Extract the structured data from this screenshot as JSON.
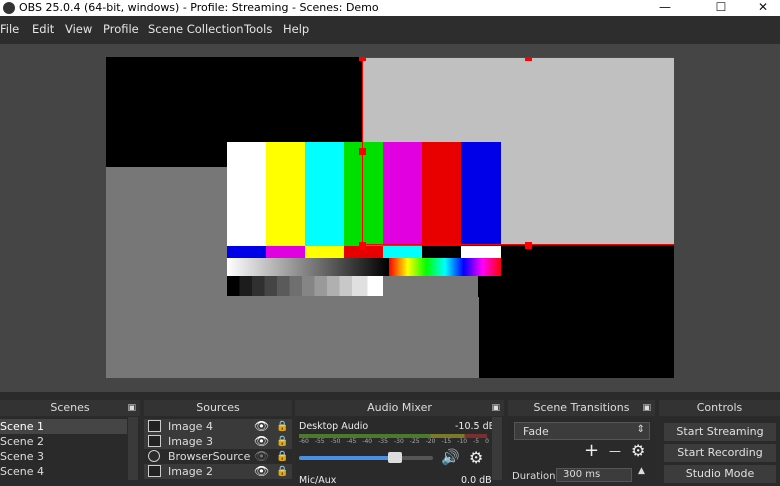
{
  "window": {
    "title": "OBS 25.0.4 (64-bit, windows) - Profile: Streaming - Scenes: Demo",
    "min_glyph": "—",
    "max_glyph": "☐",
    "close_glyph": "✕"
  },
  "menu": [
    "File",
    "Edit",
    "View",
    "Profile",
    "Scene Collection",
    "Tools",
    "Help"
  ],
  "docks": {
    "scenes": {
      "title": "Scenes",
      "items": [
        "Scene 1",
        "Scene 2",
        "Scene 3",
        "Scene 4"
      ],
      "selected_index": 0
    },
    "sources": {
      "title": "Sources",
      "items": [
        {
          "name": "Image 4",
          "icon": "image-icon",
          "visible": true
        },
        {
          "name": "Image 3",
          "icon": "image-icon",
          "visible": true
        },
        {
          "name": "BrowserSource",
          "icon": "globe-icon",
          "visible": false
        },
        {
          "name": "Image 2",
          "icon": "image-icon",
          "visible": true
        }
      ]
    },
    "mixer": {
      "title": "Audio Mixer",
      "channel1_name": "Desktop Audio",
      "channel1_db": "-10.5 dB",
      "scale": [
        "-60",
        "-55",
        "-50",
        "-45",
        "-40",
        "-35",
        "-30",
        "-25",
        "-20",
        "-15",
        "-10",
        "-5",
        "0"
      ],
      "volume_level": 0.72,
      "channel2_name": "Mic/Aux",
      "channel2_db": "0.0 dB"
    },
    "transitions": {
      "title": "Scene Transitions",
      "selected": "Fade",
      "add_glyph": "+",
      "remove_glyph": "—",
      "duration_label": "Duration",
      "duration_value": "300 ms"
    },
    "controls": {
      "title": "Controls",
      "start_streaming": "Start Streaming",
      "start_recording": "Start Recording",
      "studio_mode": "Studio Mode"
    }
  },
  "colors": {
    "accent": "#4a90e2",
    "selection": "#ff0000"
  }
}
